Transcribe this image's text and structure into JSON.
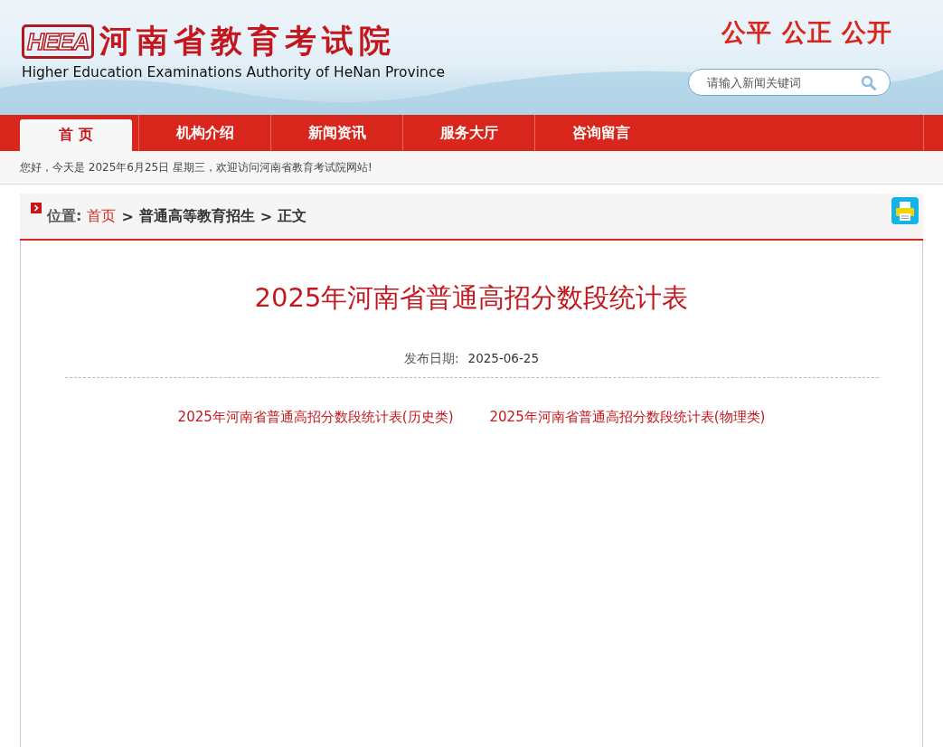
{
  "header": {
    "logo_mark": "HEEA",
    "title": "河南省教育考试院",
    "subtitle": "Higher Education Examinations Authority of HeNan Province",
    "slogan": "公平 公正 公开",
    "search": {
      "placeholder": "请输入新闻关键词"
    }
  },
  "nav": [
    {
      "label": "首 页",
      "selected": true
    },
    {
      "label": "机构介绍",
      "selected": false
    },
    {
      "label": "新闻资讯",
      "selected": false
    },
    {
      "label": "服务大厅",
      "selected": false
    },
    {
      "label": "咨询留言",
      "selected": false
    }
  ],
  "greeting": "您好，今天是 2025年6月25日 星期三，欢迎访问河南省教育考试院网站!",
  "breadcrumb": {
    "label": "位置:",
    "items": [
      {
        "text": "首页",
        "kind": "link"
      },
      {
        "text": ">",
        "kind": "sep"
      },
      {
        "text": "普通高等教育招生",
        "kind": "crumb"
      },
      {
        "text": ">",
        "kind": "sep"
      },
      {
        "text": "正文",
        "kind": "crumb"
      }
    ]
  },
  "article": {
    "title": "2025年河南省普通高招分数段统计表",
    "date_label": "发布日期:",
    "date": "2025-06-25",
    "links": [
      "2025年河南省普通高招分数段统计表(历史类)",
      "2025年河南省普通高招分数段统计表(物理类)"
    ]
  }
}
